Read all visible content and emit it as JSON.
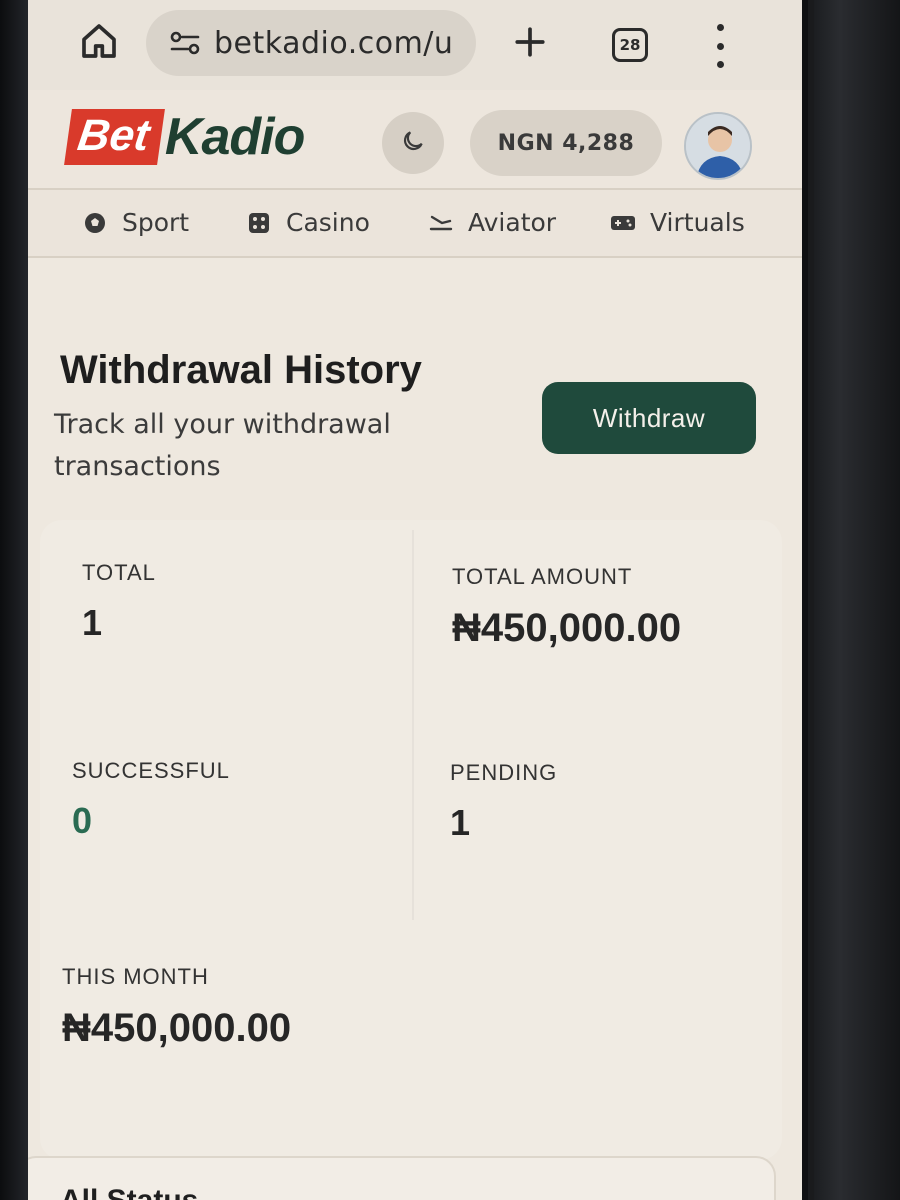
{
  "browser": {
    "url": "betkadio.com/u",
    "tab_count": "28"
  },
  "header": {
    "logo_bet": "Bet",
    "logo_kadio": "Kadio",
    "balance": "NGN 4,288"
  },
  "nav": {
    "items": [
      {
        "label": "Sport",
        "icon": "soccer-ball-icon"
      },
      {
        "label": "Casino",
        "icon": "dice-icon"
      },
      {
        "label": "Aviator",
        "icon": "plane-icon"
      },
      {
        "label": "Virtuals",
        "icon": "gamepad-icon"
      }
    ]
  },
  "page": {
    "title": "Withdrawal History",
    "subtitle": "Track all your withdrawal transactions",
    "withdraw_label": "Withdraw"
  },
  "stats": {
    "total_label": "TOTAL",
    "total_value": "1",
    "total_amount_label": "TOTAL AMOUNT",
    "total_amount_value": "₦450,000.00",
    "successful_label": "SUCCESSFUL",
    "successful_value": "0",
    "pending_label": "PENDING",
    "pending_value": "1",
    "this_month_label": "THIS MONTH",
    "this_month_value": "₦450,000.00"
  },
  "filter": {
    "status_label": "All Status"
  },
  "colors": {
    "brand_red": "#d93a2b",
    "brand_green": "#1f4a3c",
    "success_green": "#2a6b52"
  }
}
